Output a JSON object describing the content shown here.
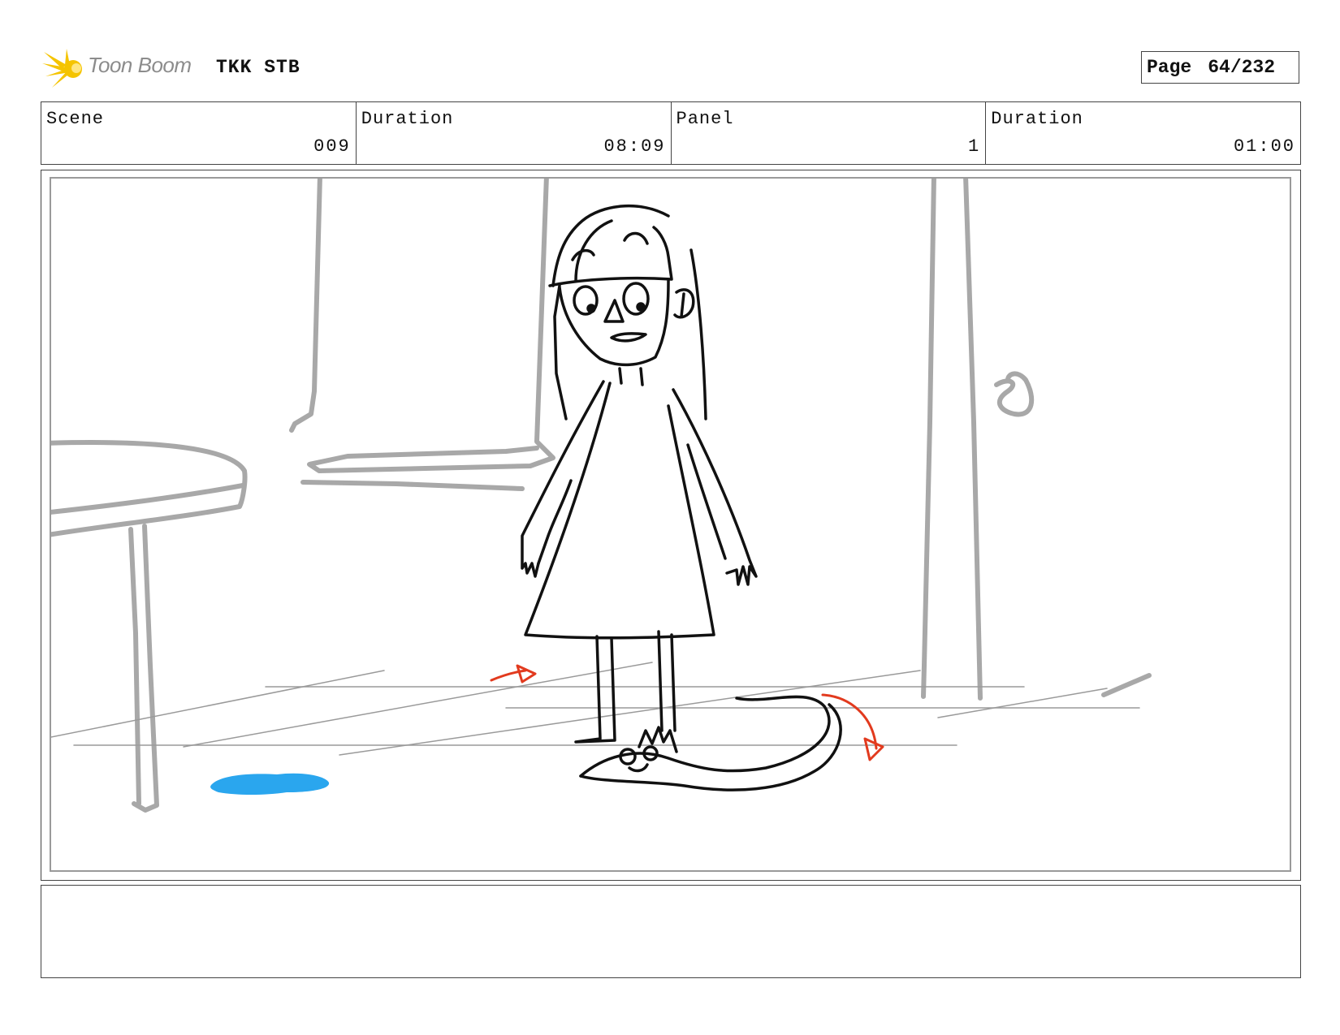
{
  "header": {
    "logo_text": "Toon Boom",
    "project_title": "TKK STB",
    "page_label": "Page",
    "page_number": "64/232"
  },
  "info": {
    "scene_label": "Scene",
    "scene_value": "009",
    "scene_duration_label": "Duration",
    "scene_duration_value": "08:09",
    "panel_label": "Panel",
    "panel_value": "1",
    "panel_duration_label": "Duration",
    "panel_duration_value": "01:00"
  },
  "colors": {
    "logo_yellow": "#f5c400",
    "sketch_gray": "#a8a8a8",
    "sketch_black": "#111111",
    "arrow_red": "#e23a1e",
    "puddle_blue": "#2aa6ee"
  },
  "notes": {
    "text": ""
  }
}
